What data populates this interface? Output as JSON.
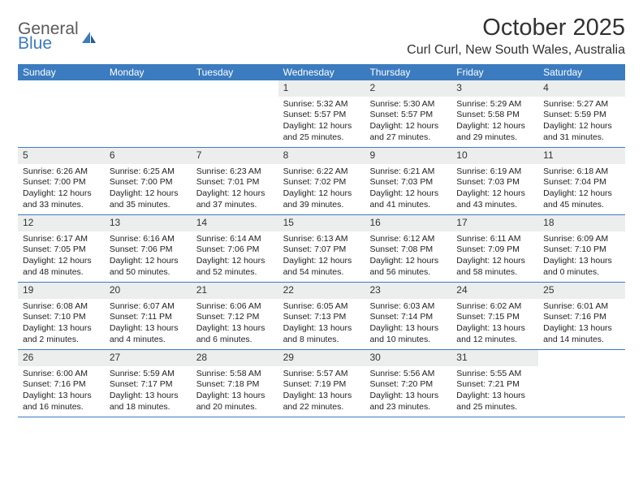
{
  "logo": {
    "line1": "General",
    "line2": "Blue"
  },
  "title": "October 2025",
  "location": "Curl Curl, New South Wales, Australia",
  "weekdays": [
    "Sunday",
    "Monday",
    "Tuesday",
    "Wednesday",
    "Thursday",
    "Friday",
    "Saturday"
  ],
  "weeks": [
    [
      null,
      null,
      null,
      {
        "n": "1",
        "sr": "Sunrise: 5:32 AM",
        "ss": "Sunset: 5:57 PM",
        "dl": "Daylight: 12 hours and 25 minutes."
      },
      {
        "n": "2",
        "sr": "Sunrise: 5:30 AM",
        "ss": "Sunset: 5:57 PM",
        "dl": "Daylight: 12 hours and 27 minutes."
      },
      {
        "n": "3",
        "sr": "Sunrise: 5:29 AM",
        "ss": "Sunset: 5:58 PM",
        "dl": "Daylight: 12 hours and 29 minutes."
      },
      {
        "n": "4",
        "sr": "Sunrise: 5:27 AM",
        "ss": "Sunset: 5:59 PM",
        "dl": "Daylight: 12 hours and 31 minutes."
      }
    ],
    [
      {
        "n": "5",
        "sr": "Sunrise: 6:26 AM",
        "ss": "Sunset: 7:00 PM",
        "dl": "Daylight: 12 hours and 33 minutes."
      },
      {
        "n": "6",
        "sr": "Sunrise: 6:25 AM",
        "ss": "Sunset: 7:00 PM",
        "dl": "Daylight: 12 hours and 35 minutes."
      },
      {
        "n": "7",
        "sr": "Sunrise: 6:23 AM",
        "ss": "Sunset: 7:01 PM",
        "dl": "Daylight: 12 hours and 37 minutes."
      },
      {
        "n": "8",
        "sr": "Sunrise: 6:22 AM",
        "ss": "Sunset: 7:02 PM",
        "dl": "Daylight: 12 hours and 39 minutes."
      },
      {
        "n": "9",
        "sr": "Sunrise: 6:21 AM",
        "ss": "Sunset: 7:03 PM",
        "dl": "Daylight: 12 hours and 41 minutes."
      },
      {
        "n": "10",
        "sr": "Sunrise: 6:19 AM",
        "ss": "Sunset: 7:03 PM",
        "dl": "Daylight: 12 hours and 43 minutes."
      },
      {
        "n": "11",
        "sr": "Sunrise: 6:18 AM",
        "ss": "Sunset: 7:04 PM",
        "dl": "Daylight: 12 hours and 45 minutes."
      }
    ],
    [
      {
        "n": "12",
        "sr": "Sunrise: 6:17 AM",
        "ss": "Sunset: 7:05 PM",
        "dl": "Daylight: 12 hours and 48 minutes."
      },
      {
        "n": "13",
        "sr": "Sunrise: 6:16 AM",
        "ss": "Sunset: 7:06 PM",
        "dl": "Daylight: 12 hours and 50 minutes."
      },
      {
        "n": "14",
        "sr": "Sunrise: 6:14 AM",
        "ss": "Sunset: 7:06 PM",
        "dl": "Daylight: 12 hours and 52 minutes."
      },
      {
        "n": "15",
        "sr": "Sunrise: 6:13 AM",
        "ss": "Sunset: 7:07 PM",
        "dl": "Daylight: 12 hours and 54 minutes."
      },
      {
        "n": "16",
        "sr": "Sunrise: 6:12 AM",
        "ss": "Sunset: 7:08 PM",
        "dl": "Daylight: 12 hours and 56 minutes."
      },
      {
        "n": "17",
        "sr": "Sunrise: 6:11 AM",
        "ss": "Sunset: 7:09 PM",
        "dl": "Daylight: 12 hours and 58 minutes."
      },
      {
        "n": "18",
        "sr": "Sunrise: 6:09 AM",
        "ss": "Sunset: 7:10 PM",
        "dl": "Daylight: 13 hours and 0 minutes."
      }
    ],
    [
      {
        "n": "19",
        "sr": "Sunrise: 6:08 AM",
        "ss": "Sunset: 7:10 PM",
        "dl": "Daylight: 13 hours and 2 minutes."
      },
      {
        "n": "20",
        "sr": "Sunrise: 6:07 AM",
        "ss": "Sunset: 7:11 PM",
        "dl": "Daylight: 13 hours and 4 minutes."
      },
      {
        "n": "21",
        "sr": "Sunrise: 6:06 AM",
        "ss": "Sunset: 7:12 PM",
        "dl": "Daylight: 13 hours and 6 minutes."
      },
      {
        "n": "22",
        "sr": "Sunrise: 6:05 AM",
        "ss": "Sunset: 7:13 PM",
        "dl": "Daylight: 13 hours and 8 minutes."
      },
      {
        "n": "23",
        "sr": "Sunrise: 6:03 AM",
        "ss": "Sunset: 7:14 PM",
        "dl": "Daylight: 13 hours and 10 minutes."
      },
      {
        "n": "24",
        "sr": "Sunrise: 6:02 AM",
        "ss": "Sunset: 7:15 PM",
        "dl": "Daylight: 13 hours and 12 minutes."
      },
      {
        "n": "25",
        "sr": "Sunrise: 6:01 AM",
        "ss": "Sunset: 7:16 PM",
        "dl": "Daylight: 13 hours and 14 minutes."
      }
    ],
    [
      {
        "n": "26",
        "sr": "Sunrise: 6:00 AM",
        "ss": "Sunset: 7:16 PM",
        "dl": "Daylight: 13 hours and 16 minutes."
      },
      {
        "n": "27",
        "sr": "Sunrise: 5:59 AM",
        "ss": "Sunset: 7:17 PM",
        "dl": "Daylight: 13 hours and 18 minutes."
      },
      {
        "n": "28",
        "sr": "Sunrise: 5:58 AM",
        "ss": "Sunset: 7:18 PM",
        "dl": "Daylight: 13 hours and 20 minutes."
      },
      {
        "n": "29",
        "sr": "Sunrise: 5:57 AM",
        "ss": "Sunset: 7:19 PM",
        "dl": "Daylight: 13 hours and 22 minutes."
      },
      {
        "n": "30",
        "sr": "Sunrise: 5:56 AM",
        "ss": "Sunset: 7:20 PM",
        "dl": "Daylight: 13 hours and 23 minutes."
      },
      {
        "n": "31",
        "sr": "Sunrise: 5:55 AM",
        "ss": "Sunset: 7:21 PM",
        "dl": "Daylight: 13 hours and 25 minutes."
      },
      null
    ]
  ]
}
